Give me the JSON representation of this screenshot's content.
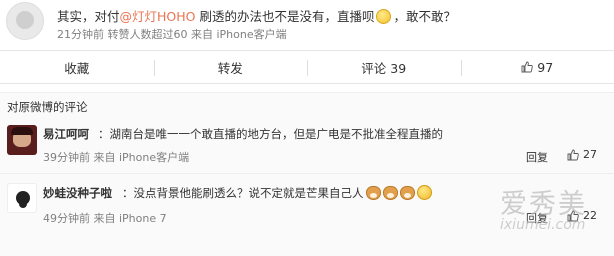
{
  "post": {
    "text_before": "其实，对付",
    "mention": "@灯灯HOHO",
    "text_after": " 刷透的办法也不是没有，直播呗",
    "text_end": "，敢不敢？",
    "meta": "21分钟前 转赞人数超过60 来自 iPhone客户端"
  },
  "actions": {
    "favorite": "收藏",
    "repost": "转发",
    "comment": "评论 39",
    "like": "97"
  },
  "comments_section": {
    "title": "对原微博的评论"
  },
  "comments": [
    {
      "user": "易江呵呵",
      "separator": "：",
      "text": "湖南台是唯一一个敢直播的地方台，但是广电是不批准全程直播的",
      "meta": "39分钟前 来自 iPhone客户端",
      "reply": "回复",
      "likes": "27"
    },
    {
      "user": "妙蛙没种子啦",
      "separator": "：",
      "text": "没点背景他能刷透么？说不定就是芒果自己人",
      "meta": "49分钟前 来自 iPhone 7",
      "reply": "回复",
      "likes": "22"
    }
  ],
  "watermark": {
    "line1": "爱秀美",
    "line2": "ixiumei.com"
  },
  "colors": {
    "mention": "#eb7350",
    "meta": "#808080",
    "background_comments": "#fafafa"
  }
}
